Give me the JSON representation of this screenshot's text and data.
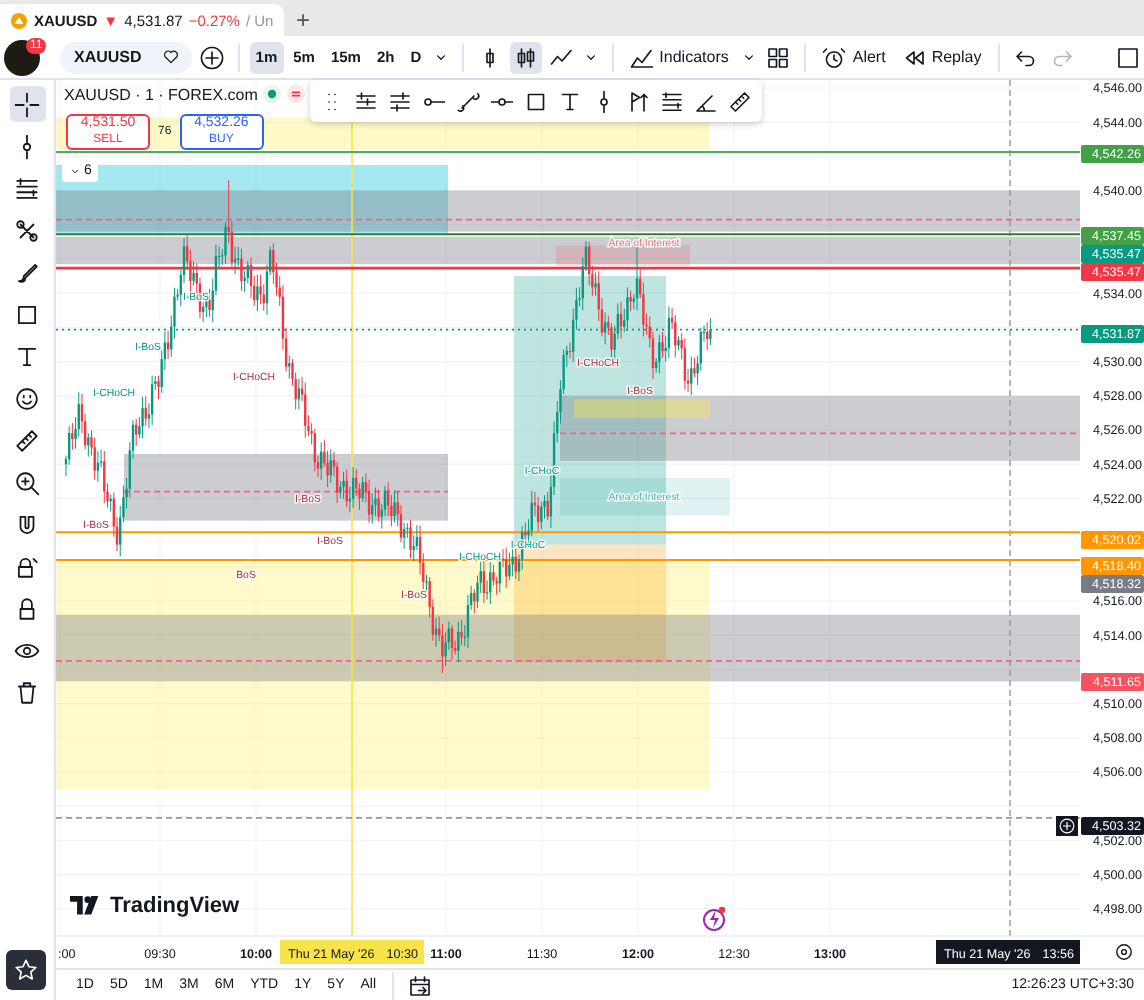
{
  "tab": {
    "symbol": "XAUUSD",
    "direction": "▼",
    "price": "4,531.87",
    "change": "−0.27%",
    "suffix": "/ Un",
    "add": "+"
  },
  "toolbar": {
    "notifications": "11",
    "symbol": "XAUUSD",
    "intervals": [
      {
        "label": "1m",
        "selected": true
      },
      {
        "label": "5m",
        "selected": false
      },
      {
        "label": "15m",
        "selected": false
      },
      {
        "label": "2h",
        "selected": false
      },
      {
        "label": "D",
        "selected": false
      }
    ],
    "chart_types": [
      {
        "kind": "bars",
        "selected": false
      },
      {
        "kind": "candles",
        "selected": true
      },
      {
        "kind": "line",
        "selected": false
      }
    ],
    "indicators": "Indicators",
    "alert": "Alert",
    "replay": "Replay",
    "redo_disabled": true
  },
  "left_tools": [
    {
      "kind": "crosshair",
      "selected": true
    },
    {
      "kind": "vline",
      "selected": false
    },
    {
      "kind": "lines",
      "selected": false
    },
    {
      "kind": "nodes",
      "selected": false
    },
    {
      "kind": "brush",
      "selected": false
    },
    {
      "kind": "rect",
      "selected": false
    },
    {
      "kind": "text",
      "selected": false
    },
    {
      "kind": "smile",
      "selected": false
    },
    {
      "kind": "ruler",
      "selected": false
    },
    {
      "kind": "zoom",
      "selected": false
    },
    {
      "kind": "magnet",
      "selected": false
    },
    {
      "kind": "lockpen",
      "selected": false
    },
    {
      "kind": "lock",
      "selected": false
    },
    {
      "kind": "eye",
      "selected": false
    },
    {
      "kind": "trash",
      "selected": false
    }
  ],
  "legend": {
    "title": "XAUUSD · 1 · FOREX.com",
    "sell": {
      "price": "4,531.50",
      "label": "SELL"
    },
    "spread": "76",
    "buy": {
      "price": "4,532.26",
      "label": "BUY"
    },
    "collapsed_count": "6"
  },
  "chart": {
    "logo": "TradingView",
    "price_labels": [
      "4,546.00",
      "4,544.00",
      "4,540.00",
      "4,534.00",
      "4,530.00",
      "4,528.00",
      "4,526.00",
      "4,524.00",
      "4,522.00",
      "4,516.00",
      "4,514.00",
      "4,510.00",
      "4,508.00",
      "4,506.00",
      "4,502.00",
      "4,500.00",
      "4,498.00"
    ],
    "price_tags": [
      {
        "text": "4,542.26",
        "color": "#43a047"
      },
      {
        "text": "4,537.45",
        "color": "#43a047"
      },
      {
        "text": "4,535.47",
        "color": "#089981"
      },
      {
        "text": "4,535.47",
        "color": "#f23645"
      },
      {
        "text": "4,531.87",
        "color": "#089981"
      },
      {
        "text": "4,520.02",
        "color": "#ff9800"
      },
      {
        "text": "4,518.40",
        "color": "#ff9800"
      },
      {
        "text": "4,518.32",
        "color": "#787b86"
      },
      {
        "text": "4,511.65",
        "color": "#f7525f"
      },
      {
        "text": "4,503.32",
        "color": "#131722"
      }
    ],
    "annotations": [
      {
        "text": "Area of Interest",
        "kind": "zone-bearish"
      },
      {
        "text": "I-BoS",
        "kind": "bullish"
      },
      {
        "text": "I-BoS",
        "kind": "bullish"
      },
      {
        "text": "I-CHoCH",
        "kind": "bearish"
      },
      {
        "text": "I-CHoCH",
        "kind": "bearish"
      },
      {
        "text": "I-BoS",
        "kind": "bearish"
      },
      {
        "text": "I-CHoCH",
        "kind": "bullish"
      },
      {
        "text": "I-CHoC",
        "kind": "bullish"
      },
      {
        "text": "Area of Interest",
        "kind": "zone-bullish"
      },
      {
        "text": "I-BoS",
        "kind": "bearish"
      },
      {
        "text": "I-BoS",
        "kind": "bearish"
      },
      {
        "text": "I-BoS",
        "kind": "bearish"
      },
      {
        "text": "I-CHoC",
        "kind": "bullish"
      },
      {
        "text": "I-CHoCH",
        "kind": "bullish"
      },
      {
        "text": "BoS",
        "kind": "bearish"
      },
      {
        "text": "I-BoS",
        "kind": "bearish"
      }
    ],
    "time_labels": [
      {
        "text": ":00",
        "bold": false
      },
      {
        "text": "09:30",
        "bold": false
      },
      {
        "text": "10:00",
        "bold": true
      },
      {
        "text": "11:00",
        "bold": true
      },
      {
        "text": "11:30",
        "bold": false
      },
      {
        "text": "12:00",
        "bold": true
      },
      {
        "text": "12:30",
        "bold": false
      },
      {
        "text": "13:00",
        "bold": true
      }
    ],
    "time_tags": [
      {
        "date": "Thu 21 May '26",
        "time": "10:30",
        "kind": "crosshair"
      },
      {
        "date": "Thu 21 May '26",
        "time": "13:56",
        "kind": "last"
      }
    ]
  },
  "bottom": {
    "ranges": [
      "1D",
      "5D",
      "1M",
      "3M",
      "6M",
      "YTD",
      "1Y",
      "5Y",
      "All"
    ],
    "clock": "12:26:23 UTC+3:30"
  }
}
